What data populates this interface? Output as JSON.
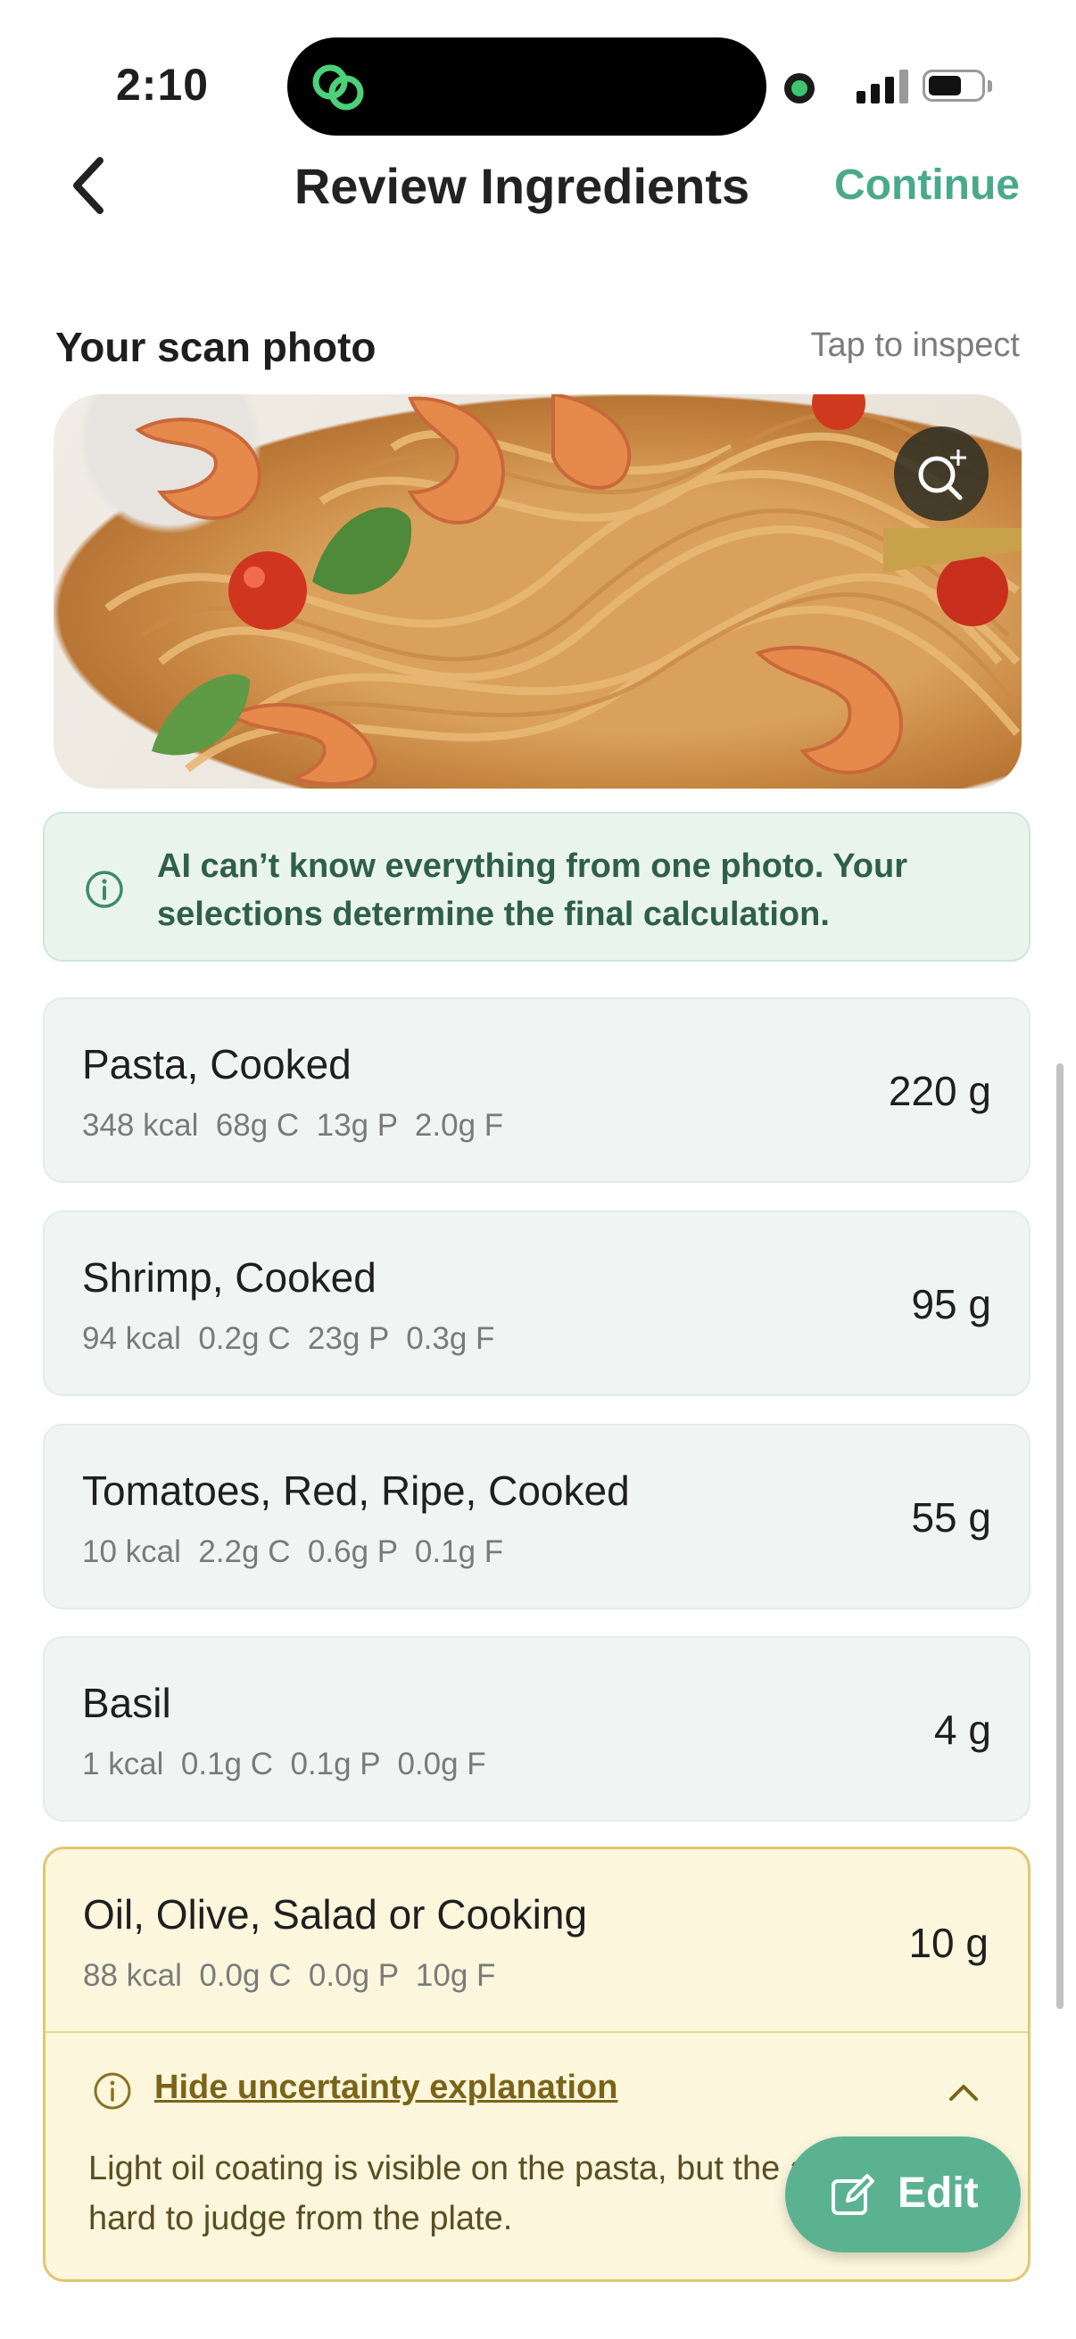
{
  "status_bar": {
    "time": "2:10"
  },
  "nav": {
    "title": "Review Ingredients",
    "continue_label": "Continue"
  },
  "scan": {
    "title": "Your scan photo",
    "hint": "Tap to inspect"
  },
  "info_banner": {
    "text": "AI can’t know everything from one photo. Your selections determine the final calculation."
  },
  "ingredients": [
    {
      "name": "Pasta, Cooked",
      "macros": "348 kcal  68g C  13g P  2.0g F",
      "quantity": "220 g"
    },
    {
      "name": "Shrimp, Cooked",
      "macros": "94 kcal  0.2g C  23g P  0.3g F",
      "quantity": "95 g"
    },
    {
      "name": "Tomatoes, Red, Ripe, Cooked",
      "macros": "10 kcal  2.2g C  0.6g P  0.1g F",
      "quantity": "55 g"
    },
    {
      "name": "Basil",
      "macros": "1 kcal  0.1g C  0.1g P  0.0g F",
      "quantity": "4 g"
    },
    {
      "name": "Oil, Olive, Salad or Cooking",
      "macros": "88 kcal  0.0g C  0.0g P  10g F",
      "quantity": "10 g",
      "uncertain": true,
      "toggle_label": "Hide uncertainty explanation",
      "explanation": "Light oil coating is visible on the pasta, but the amount is hard to judge from the plate."
    }
  ],
  "edit_button": {
    "label": "Edit"
  },
  "colors": {
    "accent": "#4aa98a",
    "edit_fab": "#5bb291",
    "info_bg": "#eaf4ef",
    "warning_bg": "#fcf6dc",
    "warning_border": "#e0c870"
  }
}
